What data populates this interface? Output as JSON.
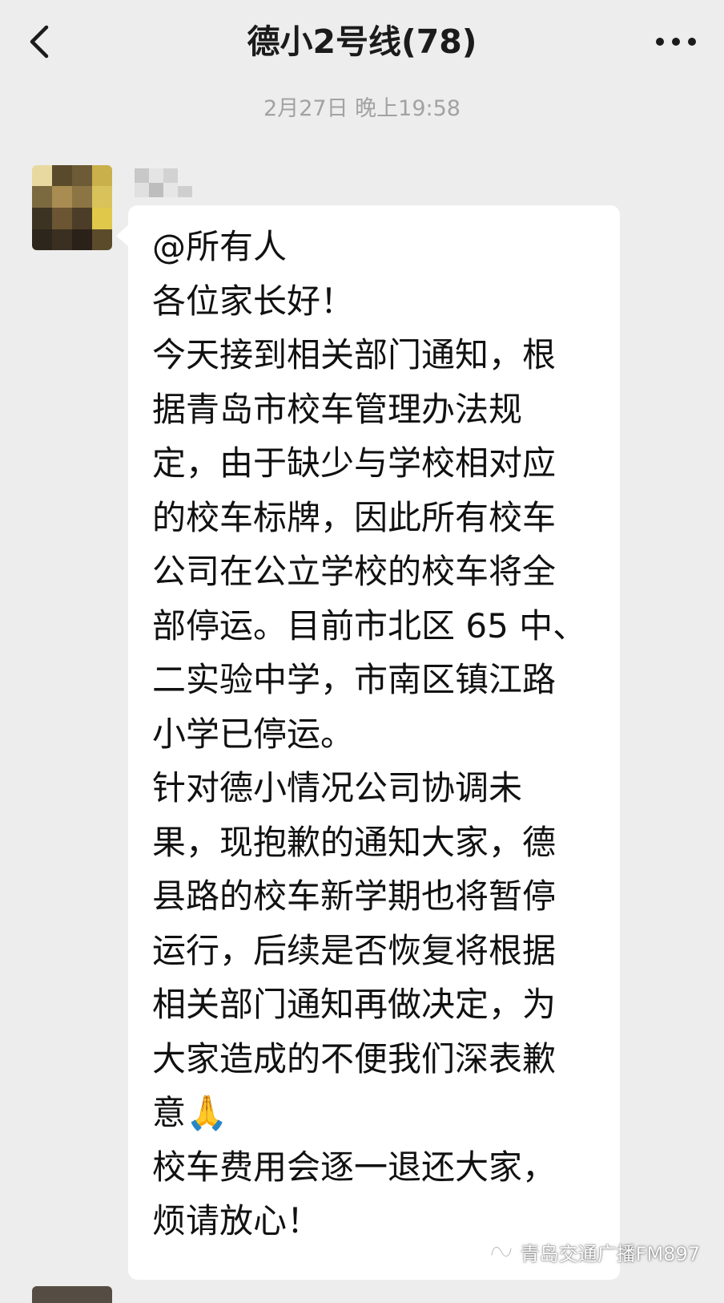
{
  "header": {
    "back_icon": "chevron-left-icon",
    "title": "德小2号线(78)",
    "more_icon": "more-dots-icon"
  },
  "chat": {
    "timestamp": "2月27日 晚上19:58",
    "message": {
      "sender_avatar": "pixelated-avatar",
      "sender_name_pixelated": true,
      "lines": [
        "@所有人",
        "各位家长好！",
        "今天接到相关部门通知，根",
        "据青岛市校车管理办法规",
        "定，由于缺少与学校相对应",
        "的校车标牌，因此所有校车",
        "公司在公立学校的校车将全",
        "部停运。目前市北区 65 中、",
        "二实验中学，市南区镇江路",
        "小学已停运。",
        "针对德小情况公司协调未",
        "果，现抱歉的通知大家，德",
        "县路的校车新学期也将暂停",
        "运行，后续是否恢复将根据",
        "相关部门通知再做决定，为",
        "大家造成的不便我们深表歉",
        "意🙏",
        "校车费用会逐一退还大家，",
        "烦请放心！"
      ]
    }
  },
  "watermark": {
    "icon": "wechat-channel-icon",
    "text": "青岛交通广播FM897"
  },
  "colors": {
    "background": "#ededed",
    "bubble": "#ffffff",
    "timestamp": "#a2a2a2"
  }
}
